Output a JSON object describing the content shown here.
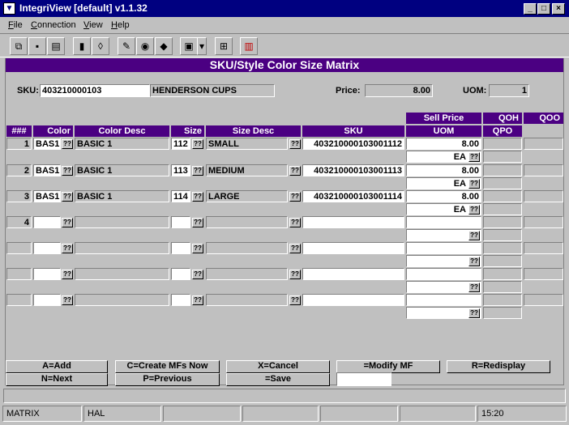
{
  "window": {
    "title": "IntegriView [default]  v1.1.32"
  },
  "menu": [
    {
      "label": "File",
      "key": "F",
      "rest": "ile"
    },
    {
      "label": "Connection",
      "key": "C",
      "rest": "onnection"
    },
    {
      "label": "View",
      "key": "V",
      "rest": "iew"
    },
    {
      "label": "Help",
      "key": "H",
      "rest": "elp"
    }
  ],
  "banner": "SKU/Style Color Size Matrix",
  "sku": {
    "label": "SKU:",
    "value": "403210000103",
    "desc": "HENDERSON CUPS"
  },
  "price": {
    "label": "Price:",
    "value": "8.00"
  },
  "uom": {
    "label": "UOM:",
    "value": "1"
  },
  "headers": {
    "num": "###",
    "color": "Color",
    "color_desc": "Color Desc",
    "size": "Size",
    "size_desc": "Size Desc",
    "sku": "SKU",
    "sell_price": "Sell Price",
    "uom": "UOM",
    "qoh": "QOH",
    "qpo": "QPO",
    "qoo": "QOO"
  },
  "lookup": "??",
  "rows": [
    {
      "num": "1",
      "color": "BAS1",
      "color_desc": "BASIC 1",
      "size": "112",
      "size_desc": "SMALL",
      "sku": "403210000103001112",
      "price": "8.00",
      "uom": "EA"
    },
    {
      "num": "2",
      "color": "BAS1",
      "color_desc": "BASIC 1",
      "size": "113",
      "size_desc": "MEDIUM",
      "sku": "403210000103001113",
      "price": "8.00",
      "uom": "EA"
    },
    {
      "num": "3",
      "color": "BAS1",
      "color_desc": "BASIC 1",
      "size": "114",
      "size_desc": "LARGE",
      "sku": "403210000103001114",
      "price": "8.00",
      "uom": "EA"
    },
    {
      "num": "4",
      "color": "",
      "color_desc": "",
      "size": "",
      "size_desc": "",
      "sku": "",
      "price": "",
      "uom": ""
    },
    {
      "num": "",
      "color": "",
      "color_desc": "",
      "size": "",
      "size_desc": "",
      "sku": "",
      "price": "",
      "uom": ""
    },
    {
      "num": "",
      "color": "",
      "color_desc": "",
      "size": "",
      "size_desc": "",
      "sku": "",
      "price": "",
      "uom": ""
    },
    {
      "num": "",
      "color": "",
      "color_desc": "",
      "size": "",
      "size_desc": "",
      "sku": "",
      "price": "",
      "uom": ""
    }
  ],
  "buttons": {
    "add": "A=Add",
    "create": "C=Create MFs Now",
    "cancel": "X=Cancel",
    "modify": "=Modify MF",
    "redisplay": "R=Redisplay",
    "next": "N=Next",
    "previous": "P=Previous",
    "save": "=Save"
  },
  "statusbar": {
    "mode": "MATRIX",
    "user": "HAL",
    "time": "15:20"
  }
}
